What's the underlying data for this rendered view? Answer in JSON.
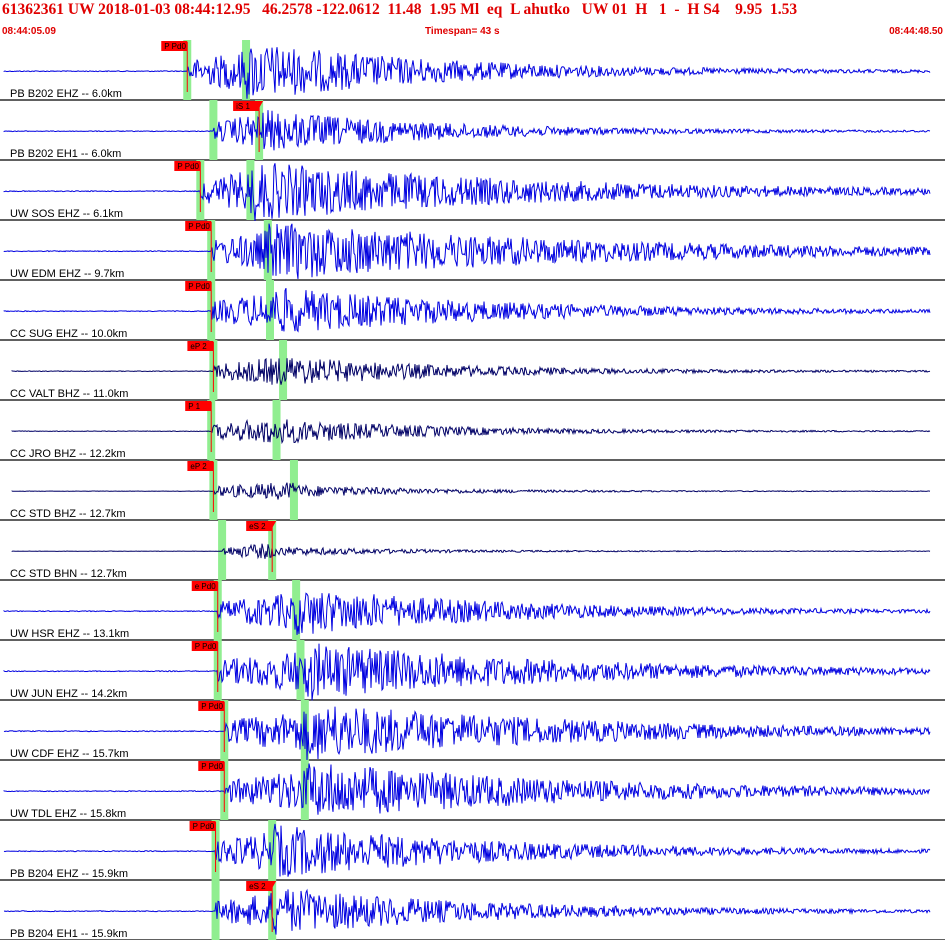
{
  "header": {
    "title": "61362361 UW 2018-01-03 08:44:12.95   46.2578 -122.0612  11.48  1.95 Ml  eq  L ahutko   UW 01  H   1  -  H S4    9.95  1.53",
    "start_time": "08:44:05.09",
    "end_time": "08:44:48.50",
    "timespan": "Timespan=  43 s"
  },
  "colors": {
    "header_text": "#e00000",
    "trace_blue": "#0000e0",
    "trace_navy": "#000066",
    "pick_red": "#ff0000",
    "pick_band_green": "#90ee90"
  },
  "traces": [
    {
      "label": "PB B202 EHZ -- 6.0km",
      "pick": "P Pd0",
      "color": "blue",
      "p_time": 8.6,
      "s_time": 11.3,
      "amp": 1.0,
      "coda": 0.35,
      "end": 0.985
    },
    {
      "label": "PB B202 EH1 -- 6.0km",
      "pick": "iS 1",
      "color": "blue",
      "p_time": 9.8,
      "s_time": 11.9,
      "amp": 0.85,
      "coda": 0.3,
      "end": 0.985,
      "s_pick": true
    },
    {
      "label": "UW SOS EHZ -- 6.1km",
      "pick": "P Pd0",
      "color": "blue",
      "p_time": 9.2,
      "s_time": 11.5,
      "amp": 1.0,
      "coda": 0.65,
      "end": 0.985
    },
    {
      "label": "UW EDM EHZ -- 9.7km",
      "pick": "P Pd0",
      "color": "blue",
      "p_time": 9.7,
      "s_time": 12.3,
      "amp": 1.0,
      "coda": 0.75,
      "end": 0.985
    },
    {
      "label": "CC SUG EHZ -- 10.0km",
      "pick": "P Pd0",
      "color": "blue",
      "p_time": 9.7,
      "s_time": 12.4,
      "amp": 0.9,
      "coda": 0.45,
      "end": 0.985
    },
    {
      "label": "CC VALT BHZ -- 11.0km",
      "pick": "eP 2",
      "color": "navy",
      "p_time": 9.8,
      "s_time": 13.0,
      "amp": 0.7,
      "coda": 0.3,
      "end": 0.985
    },
    {
      "label": "CC JRO BHZ -- 12.2km",
      "pick": "P 1",
      "color": "navy",
      "p_time": 9.7,
      "s_time": 12.7,
      "amp": 0.65,
      "coda": 0.25,
      "end": 0.985
    },
    {
      "label": "CC STD BHZ -- 12.7km",
      "pick": "eP 2",
      "color": "navy",
      "p_time": 9.8,
      "s_time": 13.5,
      "amp": 0.45,
      "coda": 0.18,
      "end": 0.985
    },
    {
      "label": "CC STD BHN -- 12.7km",
      "pick": "eS 2",
      "color": "navy",
      "p_time": 10.2,
      "s_time": 12.5,
      "amp": 0.4,
      "coda": 0.16,
      "end": 0.985,
      "s_pick": true
    },
    {
      "label": "UW HSR EHZ -- 13.1km",
      "pick": "e Pd0",
      "color": "blue",
      "p_time": 10.0,
      "s_time": 13.6,
      "amp": 0.9,
      "coda": 0.4,
      "end": 0.985
    },
    {
      "label": "UW JUN EHZ -- 14.2km",
      "pick": "P Pd0",
      "color": "blue",
      "p_time": 10.0,
      "s_time": 13.8,
      "amp": 1.0,
      "coda": 0.55,
      "end": 0.985
    },
    {
      "label": "UW CDF EHZ -- 15.7km",
      "pick": "P Pd0",
      "color": "blue",
      "p_time": 10.3,
      "s_time": 14.0,
      "amp": 1.0,
      "coda": 0.6,
      "end": 0.985
    },
    {
      "label": "UW TDL EHZ -- 15.8km",
      "pick": "P Pd0",
      "color": "blue",
      "p_time": 10.3,
      "s_time": 14.0,
      "amp": 1.0,
      "coda": 0.6,
      "end": 0.985
    },
    {
      "label": "PB B204 EHZ -- 15.9km",
      "pick": "P Pd0",
      "color": "blue",
      "p_time": 9.9,
      "s_time": 12.5,
      "amp": 0.95,
      "coda": 0.45,
      "end": 0.985
    },
    {
      "label": "PB B204 EH1 -- 15.9km",
      "pick": "eS 2",
      "color": "blue",
      "p_time": 9.9,
      "s_time": 12.5,
      "amp": 0.9,
      "coda": 0.4,
      "end": 0.985,
      "s_pick": true
    }
  ]
}
